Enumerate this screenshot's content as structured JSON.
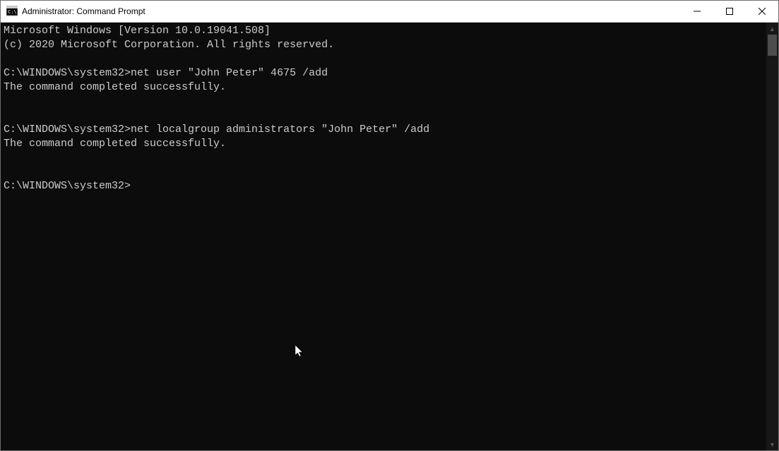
{
  "window": {
    "title": "Administrator: Command Prompt"
  },
  "terminal": {
    "lines": [
      "Microsoft Windows [Version 10.0.19041.508]",
      "(c) 2020 Microsoft Corporation. All rights reserved.",
      "",
      "C:\\WINDOWS\\system32>net user \"John Peter\" 4675 /add",
      "The command completed successfully.",
      "",
      "",
      "C:\\WINDOWS\\system32>net localgroup administrators \"John Peter\" /add",
      "The command completed successfully.",
      "",
      "",
      "C:\\WINDOWS\\system32>"
    ]
  }
}
